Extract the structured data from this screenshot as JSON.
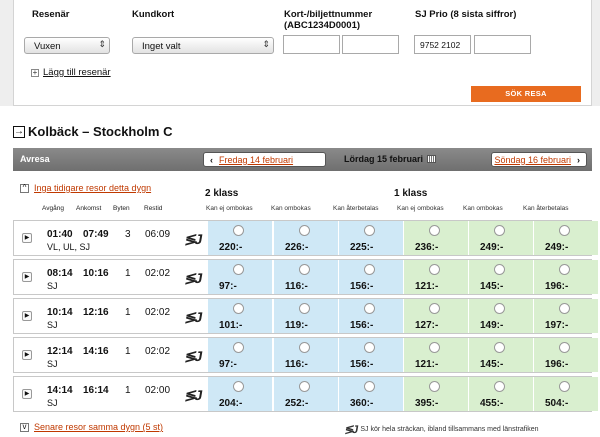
{
  "form": {
    "labels": {
      "traveler": "Resenär",
      "card": "Kundkort",
      "card_number": "Kort-/biljettnummer (ABC1234D0001)",
      "sj_prio": "SJ Prio (8 sista siffror)"
    },
    "traveler_select": "Vuxen",
    "card_select": "Inget valt",
    "card_number_value_1": "",
    "card_number_value_2": "",
    "sj_prio_value_1": "9752 2102",
    "sj_prio_value_2": "",
    "add_traveler": "Lägg till resenär",
    "search_button": "SÖK RESA"
  },
  "route": {
    "title": "Kolbäck – Stockholm C"
  },
  "datebar": {
    "label": "Avresa",
    "prev_arrow": "‹",
    "prev_date": "Fredag 14 februari",
    "current_date": "Lördag 15 februari",
    "next_date": "Söndag 16 februari",
    "next_arrow": "›"
  },
  "table": {
    "earlier_link": "Inga tidigare resor detta dygn",
    "class2": "2 klass",
    "class1": "1 klass",
    "col_headers": {
      "dep": "Avgång",
      "arr": "Ankomst",
      "changes": "Byten",
      "duration": "Restid"
    },
    "fare_headers": [
      "Kan ej ombokas",
      "Kan ombokas",
      "Kan återbetalas",
      "Kan ej ombokas",
      "Kan ombokas",
      "Kan återbetalas"
    ],
    "rows": [
      {
        "dep": "01:40",
        "arr": "07:49",
        "changes": "3",
        "duration": "06:09",
        "carrier": "VL, UL, SJ",
        "prices": [
          "220:-",
          "226:-",
          "225:-",
          "236:-",
          "249:-",
          "249:-"
        ]
      },
      {
        "dep": "08:14",
        "arr": "10:16",
        "changes": "1",
        "duration": "02:02",
        "carrier": "SJ",
        "prices": [
          "97:-",
          "116:-",
          "156:-",
          "121:-",
          "145:-",
          "196:-"
        ]
      },
      {
        "dep": "10:14",
        "arr": "12:16",
        "changes": "1",
        "duration": "02:02",
        "carrier": "SJ",
        "prices": [
          "101:-",
          "119:-",
          "156:-",
          "127:-",
          "149:-",
          "197:-"
        ]
      },
      {
        "dep": "12:14",
        "arr": "14:16",
        "changes": "1",
        "duration": "02:02",
        "carrier": "SJ",
        "prices": [
          "97:-",
          "116:-",
          "156:-",
          "121:-",
          "145:-",
          "196:-"
        ]
      },
      {
        "dep": "14:14",
        "arr": "16:14",
        "changes": "1",
        "duration": "02:00",
        "carrier": "SJ",
        "prices": [
          "204:-",
          "252:-",
          "360:-",
          "395:-",
          "455:-",
          "504:-"
        ]
      }
    ],
    "later_link": "Senare resor samma dygn (5 st)",
    "footnote": "SJ kör hela sträckan, ibland tillsammans med länstrafiken"
  },
  "icons": {
    "expand": "expand-arrow-icon",
    "sj_logo": "sj-logo-icon",
    "calendar": "calendar-icon"
  },
  "colors": {
    "accent": "#e86b1f",
    "link": "#c03900",
    "class2_bg": "#cfe8f6",
    "class1_bg": "#d9efcf",
    "band": "#7a7a7a"
  }
}
